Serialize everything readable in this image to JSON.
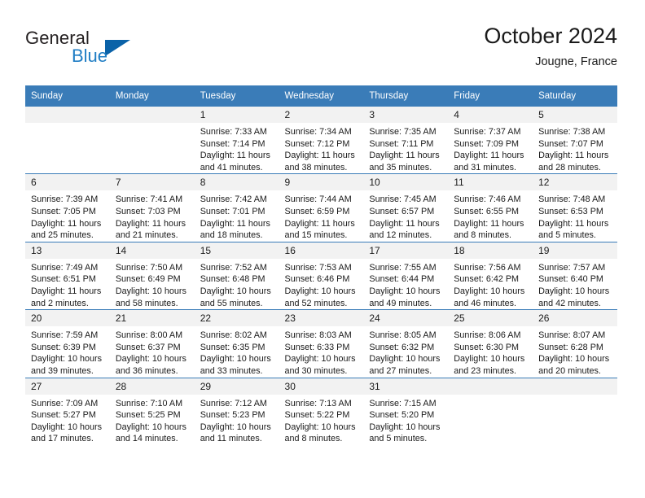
{
  "brand": {
    "name_top": "General",
    "name_bottom": "Blue",
    "accent_color": "#0a62a8",
    "blue_text_color": "#1f7dc4"
  },
  "header": {
    "title": "October 2024",
    "subtitle": "Jougne, France"
  },
  "theme": {
    "header_blue": "#3a7cb8",
    "daynum_band": "#f2f2f2",
    "text": "#1a1a1a"
  },
  "weekday_headers": [
    "Sunday",
    "Monday",
    "Tuesday",
    "Wednesday",
    "Thursday",
    "Friday",
    "Saturday"
  ],
  "labels": {
    "sunrise_prefix": "Sunrise:",
    "sunset_prefix": "Sunset:",
    "daylight_prefix": "Daylight:"
  },
  "weeks": [
    [
      {
        "day": "",
        "empty": true,
        "sunrise": "",
        "sunset": "",
        "daylight_line1": "",
        "daylight_line2": ""
      },
      {
        "day": "",
        "empty": true,
        "sunrise": "",
        "sunset": "",
        "daylight_line1": "",
        "daylight_line2": ""
      },
      {
        "day": "1",
        "empty": false,
        "sunrise": "Sunrise: 7:33 AM",
        "sunset": "Sunset: 7:14 PM",
        "daylight_line1": "Daylight: 11 hours",
        "daylight_line2": "and 41 minutes."
      },
      {
        "day": "2",
        "empty": false,
        "sunrise": "Sunrise: 7:34 AM",
        "sunset": "Sunset: 7:12 PM",
        "daylight_line1": "Daylight: 11 hours",
        "daylight_line2": "and 38 minutes."
      },
      {
        "day": "3",
        "empty": false,
        "sunrise": "Sunrise: 7:35 AM",
        "sunset": "Sunset: 7:11 PM",
        "daylight_line1": "Daylight: 11 hours",
        "daylight_line2": "and 35 minutes."
      },
      {
        "day": "4",
        "empty": false,
        "sunrise": "Sunrise: 7:37 AM",
        "sunset": "Sunset: 7:09 PM",
        "daylight_line1": "Daylight: 11 hours",
        "daylight_line2": "and 31 minutes."
      },
      {
        "day": "5",
        "empty": false,
        "sunrise": "Sunrise: 7:38 AM",
        "sunset": "Sunset: 7:07 PM",
        "daylight_line1": "Daylight: 11 hours",
        "daylight_line2": "and 28 minutes."
      }
    ],
    [
      {
        "day": "6",
        "empty": false,
        "sunrise": "Sunrise: 7:39 AM",
        "sunset": "Sunset: 7:05 PM",
        "daylight_line1": "Daylight: 11 hours",
        "daylight_line2": "and 25 minutes."
      },
      {
        "day": "7",
        "empty": false,
        "sunrise": "Sunrise: 7:41 AM",
        "sunset": "Sunset: 7:03 PM",
        "daylight_line1": "Daylight: 11 hours",
        "daylight_line2": "and 21 minutes."
      },
      {
        "day": "8",
        "empty": false,
        "sunrise": "Sunrise: 7:42 AM",
        "sunset": "Sunset: 7:01 PM",
        "daylight_line1": "Daylight: 11 hours",
        "daylight_line2": "and 18 minutes."
      },
      {
        "day": "9",
        "empty": false,
        "sunrise": "Sunrise: 7:44 AM",
        "sunset": "Sunset: 6:59 PM",
        "daylight_line1": "Daylight: 11 hours",
        "daylight_line2": "and 15 minutes."
      },
      {
        "day": "10",
        "empty": false,
        "sunrise": "Sunrise: 7:45 AM",
        "sunset": "Sunset: 6:57 PM",
        "daylight_line1": "Daylight: 11 hours",
        "daylight_line2": "and 12 minutes."
      },
      {
        "day": "11",
        "empty": false,
        "sunrise": "Sunrise: 7:46 AM",
        "sunset": "Sunset: 6:55 PM",
        "daylight_line1": "Daylight: 11 hours",
        "daylight_line2": "and 8 minutes."
      },
      {
        "day": "12",
        "empty": false,
        "sunrise": "Sunrise: 7:48 AM",
        "sunset": "Sunset: 6:53 PM",
        "daylight_line1": "Daylight: 11 hours",
        "daylight_line2": "and 5 minutes."
      }
    ],
    [
      {
        "day": "13",
        "empty": false,
        "sunrise": "Sunrise: 7:49 AM",
        "sunset": "Sunset: 6:51 PM",
        "daylight_line1": "Daylight: 11 hours",
        "daylight_line2": "and 2 minutes."
      },
      {
        "day": "14",
        "empty": false,
        "sunrise": "Sunrise: 7:50 AM",
        "sunset": "Sunset: 6:49 PM",
        "daylight_line1": "Daylight: 10 hours",
        "daylight_line2": "and 58 minutes."
      },
      {
        "day": "15",
        "empty": false,
        "sunrise": "Sunrise: 7:52 AM",
        "sunset": "Sunset: 6:48 PM",
        "daylight_line1": "Daylight: 10 hours",
        "daylight_line2": "and 55 minutes."
      },
      {
        "day": "16",
        "empty": false,
        "sunrise": "Sunrise: 7:53 AM",
        "sunset": "Sunset: 6:46 PM",
        "daylight_line1": "Daylight: 10 hours",
        "daylight_line2": "and 52 minutes."
      },
      {
        "day": "17",
        "empty": false,
        "sunrise": "Sunrise: 7:55 AM",
        "sunset": "Sunset: 6:44 PM",
        "daylight_line1": "Daylight: 10 hours",
        "daylight_line2": "and 49 minutes."
      },
      {
        "day": "18",
        "empty": false,
        "sunrise": "Sunrise: 7:56 AM",
        "sunset": "Sunset: 6:42 PM",
        "daylight_line1": "Daylight: 10 hours",
        "daylight_line2": "and 46 minutes."
      },
      {
        "day": "19",
        "empty": false,
        "sunrise": "Sunrise: 7:57 AM",
        "sunset": "Sunset: 6:40 PM",
        "daylight_line1": "Daylight: 10 hours",
        "daylight_line2": "and 42 minutes."
      }
    ],
    [
      {
        "day": "20",
        "empty": false,
        "sunrise": "Sunrise: 7:59 AM",
        "sunset": "Sunset: 6:39 PM",
        "daylight_line1": "Daylight: 10 hours",
        "daylight_line2": "and 39 minutes."
      },
      {
        "day": "21",
        "empty": false,
        "sunrise": "Sunrise: 8:00 AM",
        "sunset": "Sunset: 6:37 PM",
        "daylight_line1": "Daylight: 10 hours",
        "daylight_line2": "and 36 minutes."
      },
      {
        "day": "22",
        "empty": false,
        "sunrise": "Sunrise: 8:02 AM",
        "sunset": "Sunset: 6:35 PM",
        "daylight_line1": "Daylight: 10 hours",
        "daylight_line2": "and 33 minutes."
      },
      {
        "day": "23",
        "empty": false,
        "sunrise": "Sunrise: 8:03 AM",
        "sunset": "Sunset: 6:33 PM",
        "daylight_line1": "Daylight: 10 hours",
        "daylight_line2": "and 30 minutes."
      },
      {
        "day": "24",
        "empty": false,
        "sunrise": "Sunrise: 8:05 AM",
        "sunset": "Sunset: 6:32 PM",
        "daylight_line1": "Daylight: 10 hours",
        "daylight_line2": "and 27 minutes."
      },
      {
        "day": "25",
        "empty": false,
        "sunrise": "Sunrise: 8:06 AM",
        "sunset": "Sunset: 6:30 PM",
        "daylight_line1": "Daylight: 10 hours",
        "daylight_line2": "and 23 minutes."
      },
      {
        "day": "26",
        "empty": false,
        "sunrise": "Sunrise: 8:07 AM",
        "sunset": "Sunset: 6:28 PM",
        "daylight_line1": "Daylight: 10 hours",
        "daylight_line2": "and 20 minutes."
      }
    ],
    [
      {
        "day": "27",
        "empty": false,
        "sunrise": "Sunrise: 7:09 AM",
        "sunset": "Sunset: 5:27 PM",
        "daylight_line1": "Daylight: 10 hours",
        "daylight_line2": "and 17 minutes."
      },
      {
        "day": "28",
        "empty": false,
        "sunrise": "Sunrise: 7:10 AM",
        "sunset": "Sunset: 5:25 PM",
        "daylight_line1": "Daylight: 10 hours",
        "daylight_line2": "and 14 minutes."
      },
      {
        "day": "29",
        "empty": false,
        "sunrise": "Sunrise: 7:12 AM",
        "sunset": "Sunset: 5:23 PM",
        "daylight_line1": "Daylight: 10 hours",
        "daylight_line2": "and 11 minutes."
      },
      {
        "day": "30",
        "empty": false,
        "sunrise": "Sunrise: 7:13 AM",
        "sunset": "Sunset: 5:22 PM",
        "daylight_line1": "Daylight: 10 hours",
        "daylight_line2": "and 8 minutes."
      },
      {
        "day": "31",
        "empty": false,
        "sunrise": "Sunrise: 7:15 AM",
        "sunset": "Sunset: 5:20 PM",
        "daylight_line1": "Daylight: 10 hours",
        "daylight_line2": "and 5 minutes."
      },
      {
        "day": "",
        "empty": true,
        "sunrise": "",
        "sunset": "",
        "daylight_line1": "",
        "daylight_line2": ""
      },
      {
        "day": "",
        "empty": true,
        "sunrise": "",
        "sunset": "",
        "daylight_line1": "",
        "daylight_line2": ""
      }
    ]
  ]
}
